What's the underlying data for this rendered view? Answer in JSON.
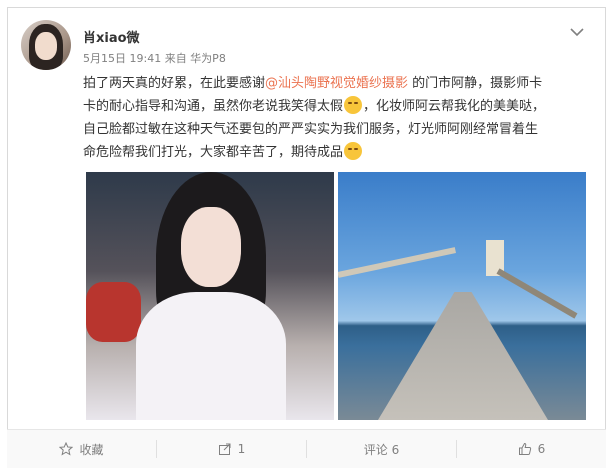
{
  "post": {
    "username": "肖xiao微",
    "meta": "5月15日 19:41 来自 华为P8",
    "text_line1_a": "拍了两天真的好累，在此要感谢",
    "mention": "@汕头陶野视觉婚纱摄影",
    "text_line1_b": " 的门市阿静，摄影师卡",
    "text_line2_a": "卡的耐心指导和沟通，虽然你老说我笑得太假",
    "text_line2_b": "，化妆师阿云帮我化的美美哒，",
    "text_line3": "自己脸都过敏在这种天气还要包的严严实实为我们服务，灯光师阿刚经常冒着生",
    "text_line4": "命危险帮我们打光，大家都辛苦了，期待成品"
  },
  "actions": {
    "favorite": "收藏",
    "repost": "1",
    "comment": "评论 6",
    "like": "6"
  },
  "icons": [
    "chevron-down-icon",
    "star-icon",
    "share-icon",
    "comment-icon",
    "thumbs-up-icon",
    "laugh-emoji",
    "sweat-emoji"
  ],
  "colors": {
    "mention": "#eb7350",
    "text": "#333333",
    "meta": "#808080"
  }
}
